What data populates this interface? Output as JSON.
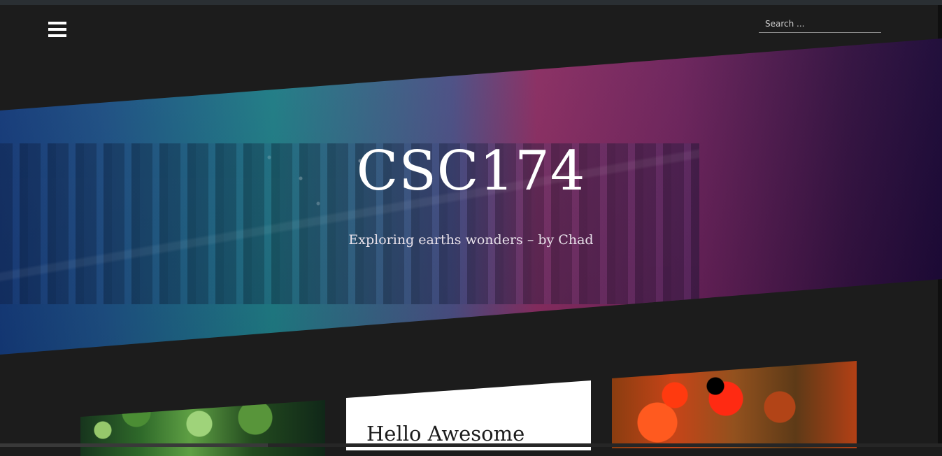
{
  "header": {
    "menu_icon": "hamburger-icon",
    "search_placeholder": "Search ..."
  },
  "hero": {
    "title": "CSC174",
    "subtitle": "Exploring earths wonders – by Chad"
  },
  "cards": [
    {
      "title": ""
    },
    {
      "title": "Hello Awesome"
    },
    {
      "title": ""
    }
  ]
}
